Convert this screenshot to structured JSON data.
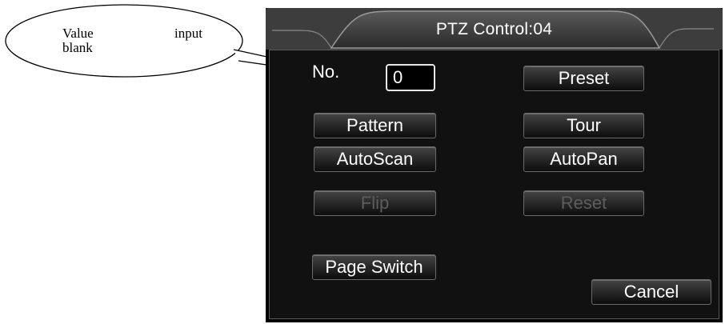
{
  "annotation": {
    "text_line1_a": "Value",
    "text_line1_b": "input",
    "text_line2": "blank"
  },
  "dialog": {
    "title": "PTZ Control:04",
    "no_label": "No.",
    "no_value": "0",
    "buttons": {
      "preset": "Preset",
      "pattern": "Pattern",
      "tour": "Tour",
      "autoscan": "AutoScan",
      "autopan": "AutoPan",
      "flip": "Flip",
      "reset": "Reset",
      "page_switch": "Page Switch",
      "cancel": "Cancel"
    }
  },
  "colors": {
    "dialog_bg": "#111111",
    "button_text": "#ffffff",
    "disabled_text": "#5d5d5d"
  }
}
